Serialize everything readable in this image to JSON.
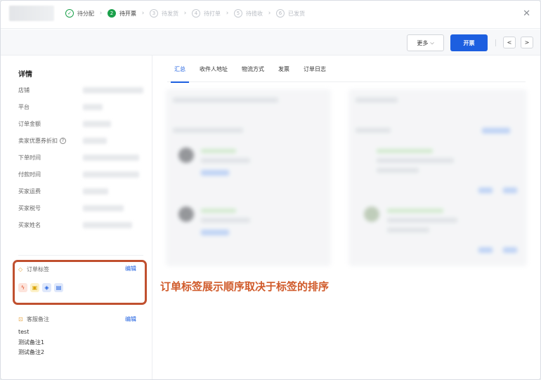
{
  "steps": [
    {
      "num": "✓",
      "label": "待分配"
    },
    {
      "num": "2",
      "label": "待开票"
    },
    {
      "num": "3",
      "label": "待发货"
    },
    {
      "num": "4",
      "label": "待打单"
    },
    {
      "num": "5",
      "label": "待揽收"
    },
    {
      "num": "6",
      "label": "已发货"
    }
  ],
  "toolbar": {
    "more_label": "更多",
    "primary_label": "开票",
    "prev": "<",
    "next": ">"
  },
  "sidebar": {
    "title": "详情",
    "fields": [
      "店铺",
      "平台",
      "订单金额",
      "卖家优惠券折扣",
      "下单时间",
      "付款时间",
      "买家运费",
      "买家税号",
      "买家姓名"
    ],
    "tags_title": "订单标签",
    "tags_edit": "编辑",
    "remark_title": "客服备注",
    "remark_edit": "编辑",
    "remarks": [
      "test",
      "测试备注1",
      "测试备注2"
    ]
  },
  "tabs": [
    "汇总",
    "收件人地址",
    "物流方式",
    "发票",
    "订单日志"
  ],
  "annotation": "订单标签展示顺序取决于标签的排序",
  "colors": {
    "accent": "#1d5fe0",
    "success": "#1aa04a",
    "highlight": "#c0502f"
  }
}
